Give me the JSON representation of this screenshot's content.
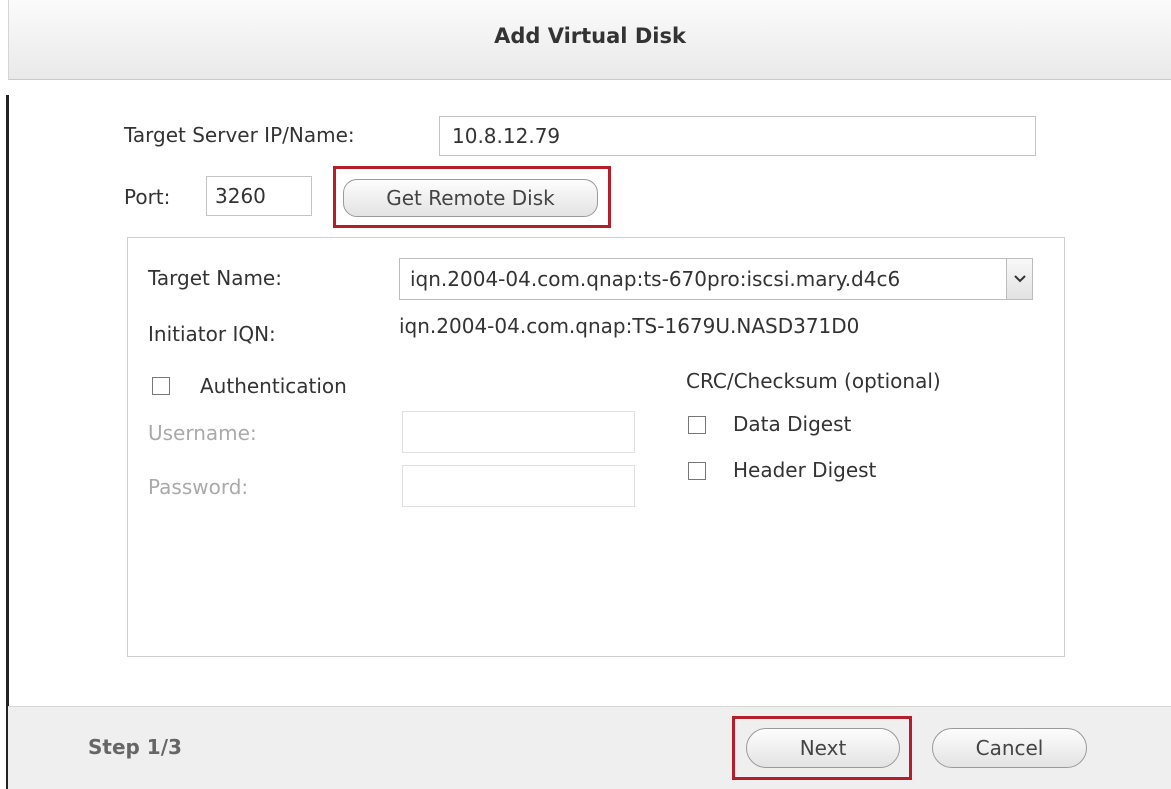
{
  "dialog": {
    "title": "Add Virtual Disk"
  },
  "connection": {
    "target_server_label": "Target Server IP/Name:",
    "target_server_value": "10.8.12.79",
    "port_label": "Port:",
    "port_value": "3260",
    "get_remote_disk_label": "Get Remote Disk"
  },
  "panel": {
    "target_name_label": "Target Name:",
    "target_name_value": "iqn.2004-04.com.qnap:ts-670pro:iscsi.mary.d4c6",
    "initiator_iqn_label": "Initiator IQN:",
    "initiator_iqn_value": "iqn.2004-04.com.qnap:TS-1679U.NASD371D0",
    "authentication_label": "Authentication",
    "username_label": "Username:",
    "username_value": "",
    "password_label": "Password:",
    "password_value": "",
    "crc_label": "CRC/Checksum (optional)",
    "data_digest_label": "Data Digest",
    "header_digest_label": "Header Digest"
  },
  "footer": {
    "step_label": "Step 1/3",
    "next_label": "Next",
    "cancel_label": "Cancel"
  },
  "icons": {
    "select_arrow": "chevron-down-icon"
  },
  "colors": {
    "highlight": "#b41e2a"
  }
}
